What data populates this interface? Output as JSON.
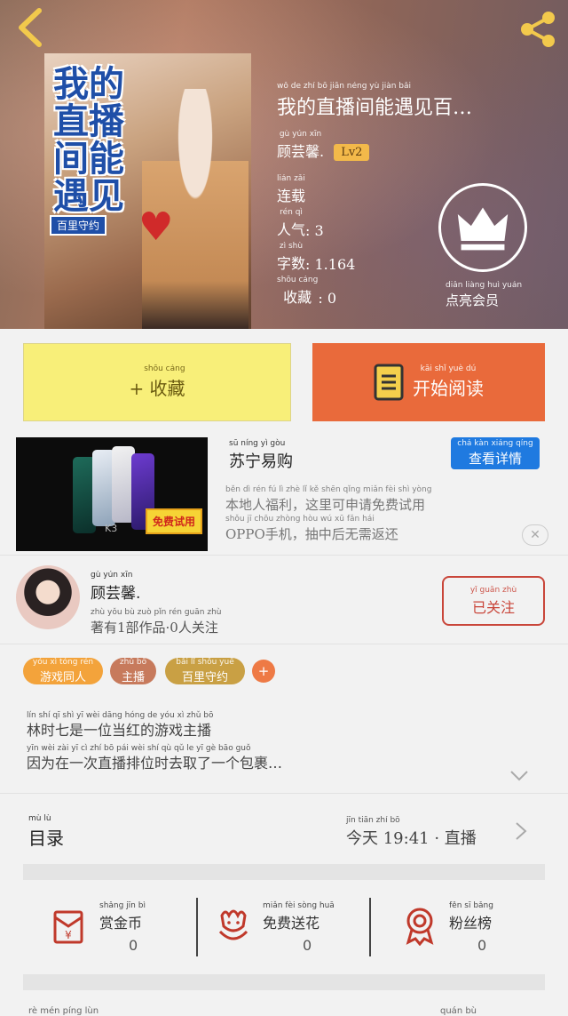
{
  "header": {
    "title": "我的直播间能遇见百…",
    "title_pinyin": "wǒ de zhí bō jiān néng yù jiàn bǎi",
    "author": "顾芸馨.",
    "author_pinyin": "gù yún xīn",
    "level": "Lv2",
    "status": "连载",
    "status_pinyin": "lián zǎi",
    "popularity_label": "人气",
    "popularity_pinyin": "rén qì",
    "popularity_value": ": 3",
    "wordcount_label": "字数",
    "wordcount_pinyin": "zì shù",
    "wordcount_value": ": 1.164",
    "favorites_label": "收藏",
    "favorites_pinyin": "shōu cáng",
    "favorites_value": ": 0",
    "vip_label": "点亮会员",
    "vip_pinyin": "diǎn liàng huì yuán",
    "cover_title": "我的直播间能遇见",
    "cover_tag": "百里守约"
  },
  "actions": {
    "favorite_label": "+ 收藏",
    "favorite_pinyin": "shōu cáng",
    "read_label": "开始阅读",
    "read_pinyin": "kāi shǐ yuè dú"
  },
  "ad": {
    "brand": "苏宁易购",
    "brand_pinyin": "sū níng yì gòu",
    "detail_label": "查看详情",
    "detail_pinyin": "chá kàn xiáng qíng",
    "desc_line1": "本地人福利，这里可申请免费试用",
    "desc_line1_pinyin": "běn dì rén fú lì zhè lǐ kě shēn qǐng miǎn fèi shì yòng",
    "desc_line2": "OPPO手机，抽中后无需返还",
    "desc_line2_pinyin": "shǒu jī chōu zhòng hòu wú xū fǎn hái",
    "phone_model": "K3",
    "badge": "免费试用",
    "close_symbol": "✕"
  },
  "author": {
    "name": "顾芸馨.",
    "name_pinyin": "gù yún xīn",
    "works": "著有1部作品·0人关注",
    "works_pinyin": "zhù yǒu bù zuò pǐn rén guān zhù",
    "follow_label": "已关注",
    "follow_pinyin": "yǐ guān zhù"
  },
  "tags": [
    {
      "label": "游戏同人",
      "pinyin": "yóu xì tóng rén",
      "color": "#f3a33b"
    },
    {
      "label": "主播",
      "pinyin": "zhǔ bō",
      "color": "#c77a5c"
    },
    {
      "label": "百里守约",
      "pinyin": "bǎi lǐ shǒu yuē",
      "color": "#c9a044"
    }
  ],
  "tag_add": "+",
  "intro": {
    "line1": "林时七是一位当红的游戏主播",
    "line1_pinyin": "lín shí qī shì yī wèi dāng hóng de yóu xì zhǔ bō",
    "line2": "因为在一次直播排位时去取了一个包裹…",
    "line2_pinyin": "yīn wèi zài yī cì zhí bō pái wèi shí qù qǔ le yī gè bāo guǒ"
  },
  "catalog": {
    "label": "目录",
    "label_pinyin": "mù lù",
    "update": "今天 19:41 · 直播",
    "update_pinyin": "jīn tiān zhí bō"
  },
  "stats": [
    {
      "label": "赏金币",
      "pinyin": "shǎng jīn bì",
      "count": "0"
    },
    {
      "label": "免费送花",
      "pinyin": "miǎn fèi sòng huā",
      "count": "0"
    },
    {
      "label": "粉丝榜",
      "pinyin": "fěn sī bǎng",
      "count": "0"
    }
  ],
  "bottom": {
    "left_pinyin": "rè mén píng lùn",
    "right_pinyin": "quán bù"
  },
  "colors": {
    "accent_orange": "#e96a3b",
    "favorite_yellow": "#f8ef79",
    "follow_red": "#c9463a",
    "link_blue": "#1f7ae0"
  }
}
